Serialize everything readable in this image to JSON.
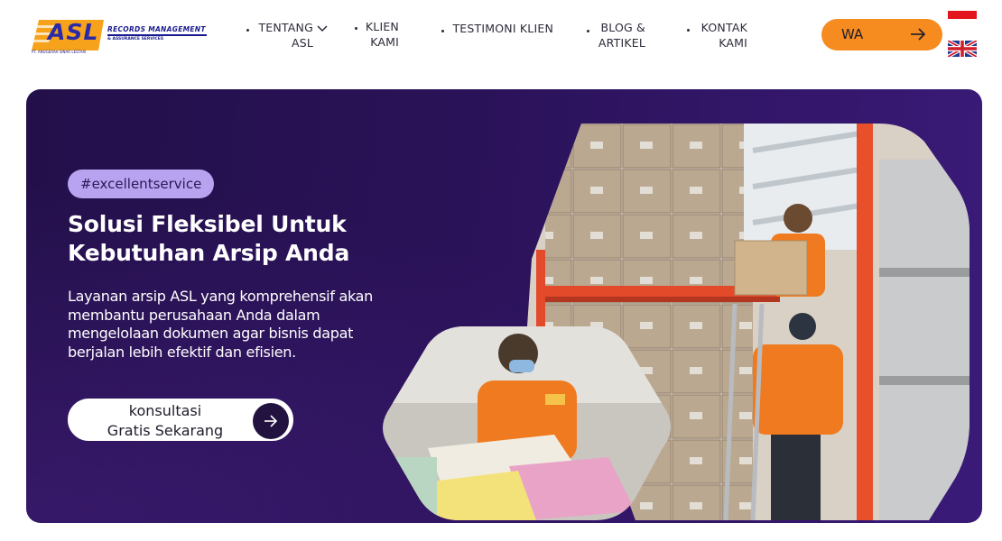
{
  "logo": {
    "brand": "ASL",
    "tagline": "RECORDS MANAGEMENT",
    "sub": "& ASSURANCE SERVICES",
    "company": "PT. ANUGERAH SINAR LESTARI"
  },
  "nav": {
    "items": [
      {
        "lines": [
          "TENTANG",
          "ASL"
        ],
        "has_dropdown": true
      },
      {
        "lines": [
          "KLIEN",
          "KAMI"
        ]
      },
      {
        "lines": [
          "TESTIMONI KLIEN"
        ]
      },
      {
        "lines": [
          "BLOG &",
          "ARTIKEL"
        ]
      },
      {
        "lines": [
          "KONTAK",
          "KAMI"
        ]
      }
    ],
    "wa_label": "WA",
    "languages": [
      "id-flag-icon",
      "uk-flag-icon"
    ]
  },
  "hero": {
    "tag": "#excellentservice",
    "title": "Solusi Fleksibel Untuk Kebutuhan Arsip Anda",
    "description": "Layanan arsip ASL yang komprehensif akan membantu perusahaan Anda dalam mengelolaan dokumen agar bisnis dapat berjalan lebih efektif dan efisien.",
    "cta": {
      "line1": "konsultasi",
      "line2": "Gratis Sekarang"
    }
  },
  "colors": {
    "accent": "#f68b1f",
    "hero_bg": "#2a1258",
    "tag_bg": "#b7a3f0",
    "brand_blue": "#2a2aa8"
  }
}
